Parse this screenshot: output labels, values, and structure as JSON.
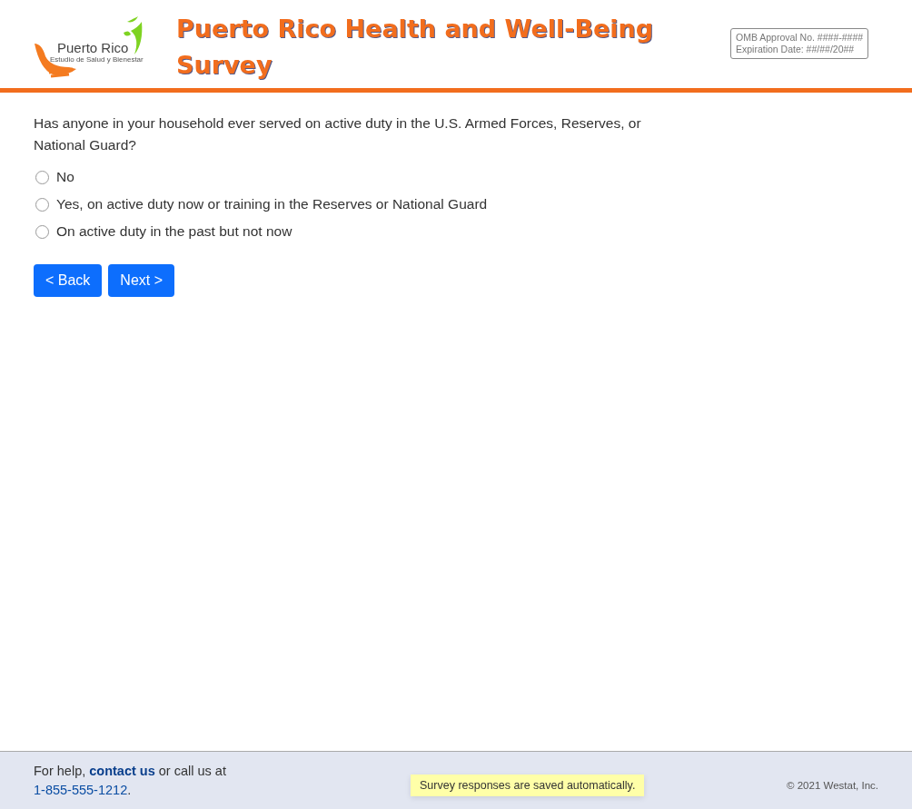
{
  "header": {
    "logo": {
      "name": "Puerto Rico",
      "tagline": "Estudio de Salud y Bienestar"
    },
    "title": "Puerto Rico Health and Well-Being Survey",
    "omb": {
      "approval": "OMB Approval No. ####-####",
      "expiration": "Expiration Date: ##/##/20##"
    }
  },
  "question": {
    "text": "Has anyone in your household ever served on active duty in the U.S. Armed Forces, Reserves, or National Guard?",
    "options": [
      {
        "label": "No",
        "selected": false
      },
      {
        "label": "Yes, on active duty now or training in the Reserves or National Guard",
        "selected": false
      },
      {
        "label": "On active duty in the past but not now",
        "selected": false
      }
    ]
  },
  "buttons": [
    "< Back",
    "Next >"
  ],
  "footer": {
    "help": {
      "before": "For help, ",
      "link": "contact us",
      "middle": " or call us at ",
      "phone": "1-855-555-1212",
      "after": "."
    },
    "notice": "Survey responses are saved automatically.",
    "copyright": "© 2021 Westat, Inc."
  }
}
